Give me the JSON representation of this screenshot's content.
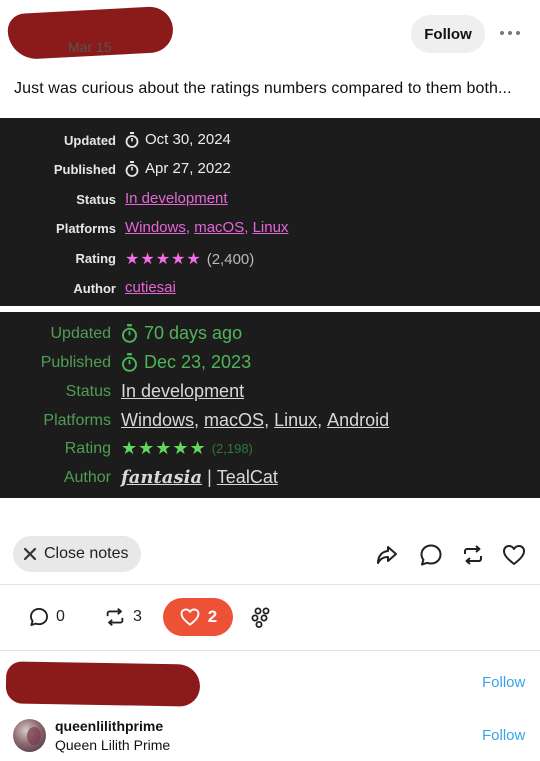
{
  "post": {
    "date": "Mar 15",
    "follow_label": "Follow",
    "caption": "Just was curious about the ratings numbers compared to them both..."
  },
  "card1": {
    "rows": [
      {
        "label": "Updated",
        "value": "Oct 30, 2024"
      },
      {
        "label": "Published",
        "value": "Apr 27, 2022"
      },
      {
        "label": "Status",
        "value": "In development"
      },
      {
        "label": "Platforms",
        "links": [
          "Windows",
          "macOS",
          "Linux"
        ]
      },
      {
        "label": "Rating",
        "stars": "★★★★★",
        "count": "(2,400)"
      },
      {
        "label": "Author",
        "value": "cutiesai"
      }
    ]
  },
  "card2": {
    "rows": [
      {
        "label": "Updated",
        "value": "70 days ago"
      },
      {
        "label": "Published",
        "value": "Dec 23, 2023"
      },
      {
        "label": "Status",
        "value": "In development"
      },
      {
        "label": "Platforms",
        "links": [
          "Windows",
          "macOS",
          "Linux",
          "Android"
        ]
      },
      {
        "label": "Rating",
        "stars": "★★★★★",
        "count": "(2,198)"
      },
      {
        "label": "Author",
        "fancy": "fantasia",
        "separator": " | ",
        "value": "TealCat"
      }
    ]
  },
  "actions": {
    "close_notes": "Close notes"
  },
  "stats": {
    "replies": "0",
    "reblogs": "3",
    "likes": "2"
  },
  "notes": [
    {
      "follow": "Follow"
    },
    {
      "username": "queenlilithprime",
      "display_name": "Queen Lilith Prime",
      "follow": "Follow"
    }
  ],
  "colors": {
    "card_bg": "#1c1c1c",
    "card1_accent": "#e566d8",
    "card2_accent": "#4fb55a",
    "like_pill": "#ee5236",
    "follow_link": "#3aa3e8",
    "redaction": "#8b1a1a"
  },
  "icons": {
    "timer": "stopwatch-icon",
    "close": "close-icon",
    "share": "share-icon",
    "reply": "reply-icon",
    "reblog": "reblog-icon",
    "like": "heart-icon",
    "more": "more-icon",
    "notes": "notes-cluster-icon"
  }
}
